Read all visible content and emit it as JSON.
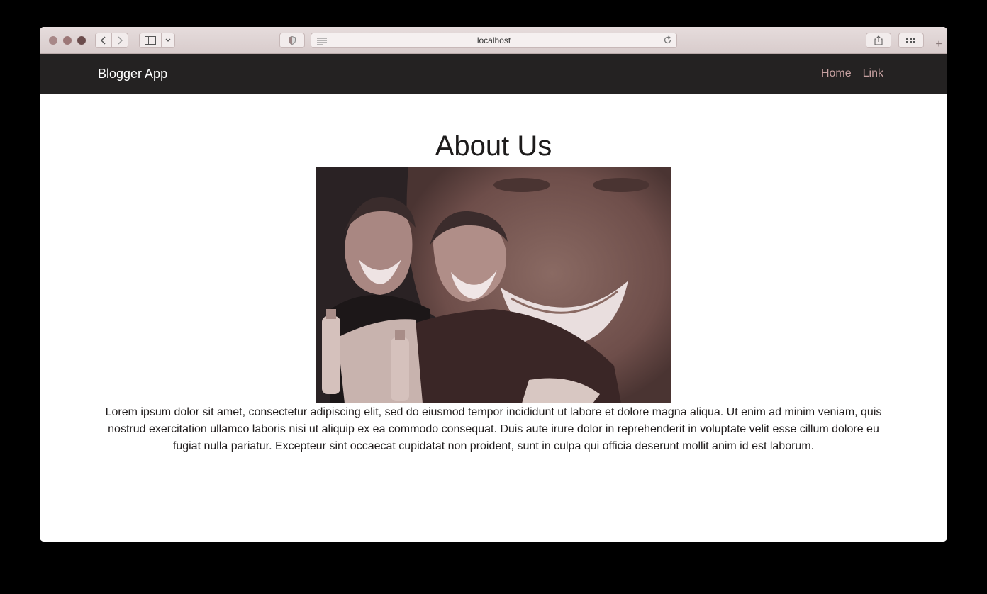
{
  "browser": {
    "url": "localhost",
    "icons": [
      "close-dot",
      "minimize-dot",
      "zoom-dot",
      "back-icon",
      "forward-icon",
      "sidebar-icon",
      "chevron-down-icon",
      "shield-icon",
      "reader-icon",
      "reload-icon",
      "share-icon",
      "tabs-grid-icon",
      "new-tab-icon"
    ]
  },
  "navbar": {
    "brand": "Blogger App",
    "links": [
      {
        "label": "Home"
      },
      {
        "label": "Link"
      }
    ]
  },
  "page": {
    "title": "About Us",
    "paragraph": "Lorem ipsum dolor sit amet, consectetur adipiscing elit, sed do eiusmod tempor incididunt ut labore et dolore magna aliqua. Ut enim ad minim veniam, quis nostrud exercitation ullamco laboris nisi ut aliquip ex ea commodo consequat. Duis aute irure dolor in reprehenderit in voluptate velit esse cillum dolore eu fugiat nulla pariatur. Excepteur sint occaecat cupidatat non proident, sunt in culpa qui officia deserunt mollit anim id est laborum."
  },
  "colors": {
    "navbar_bg": "#242222",
    "nav_link": "#c7a1a1",
    "photo_tone": "#6e4e4a"
  }
}
